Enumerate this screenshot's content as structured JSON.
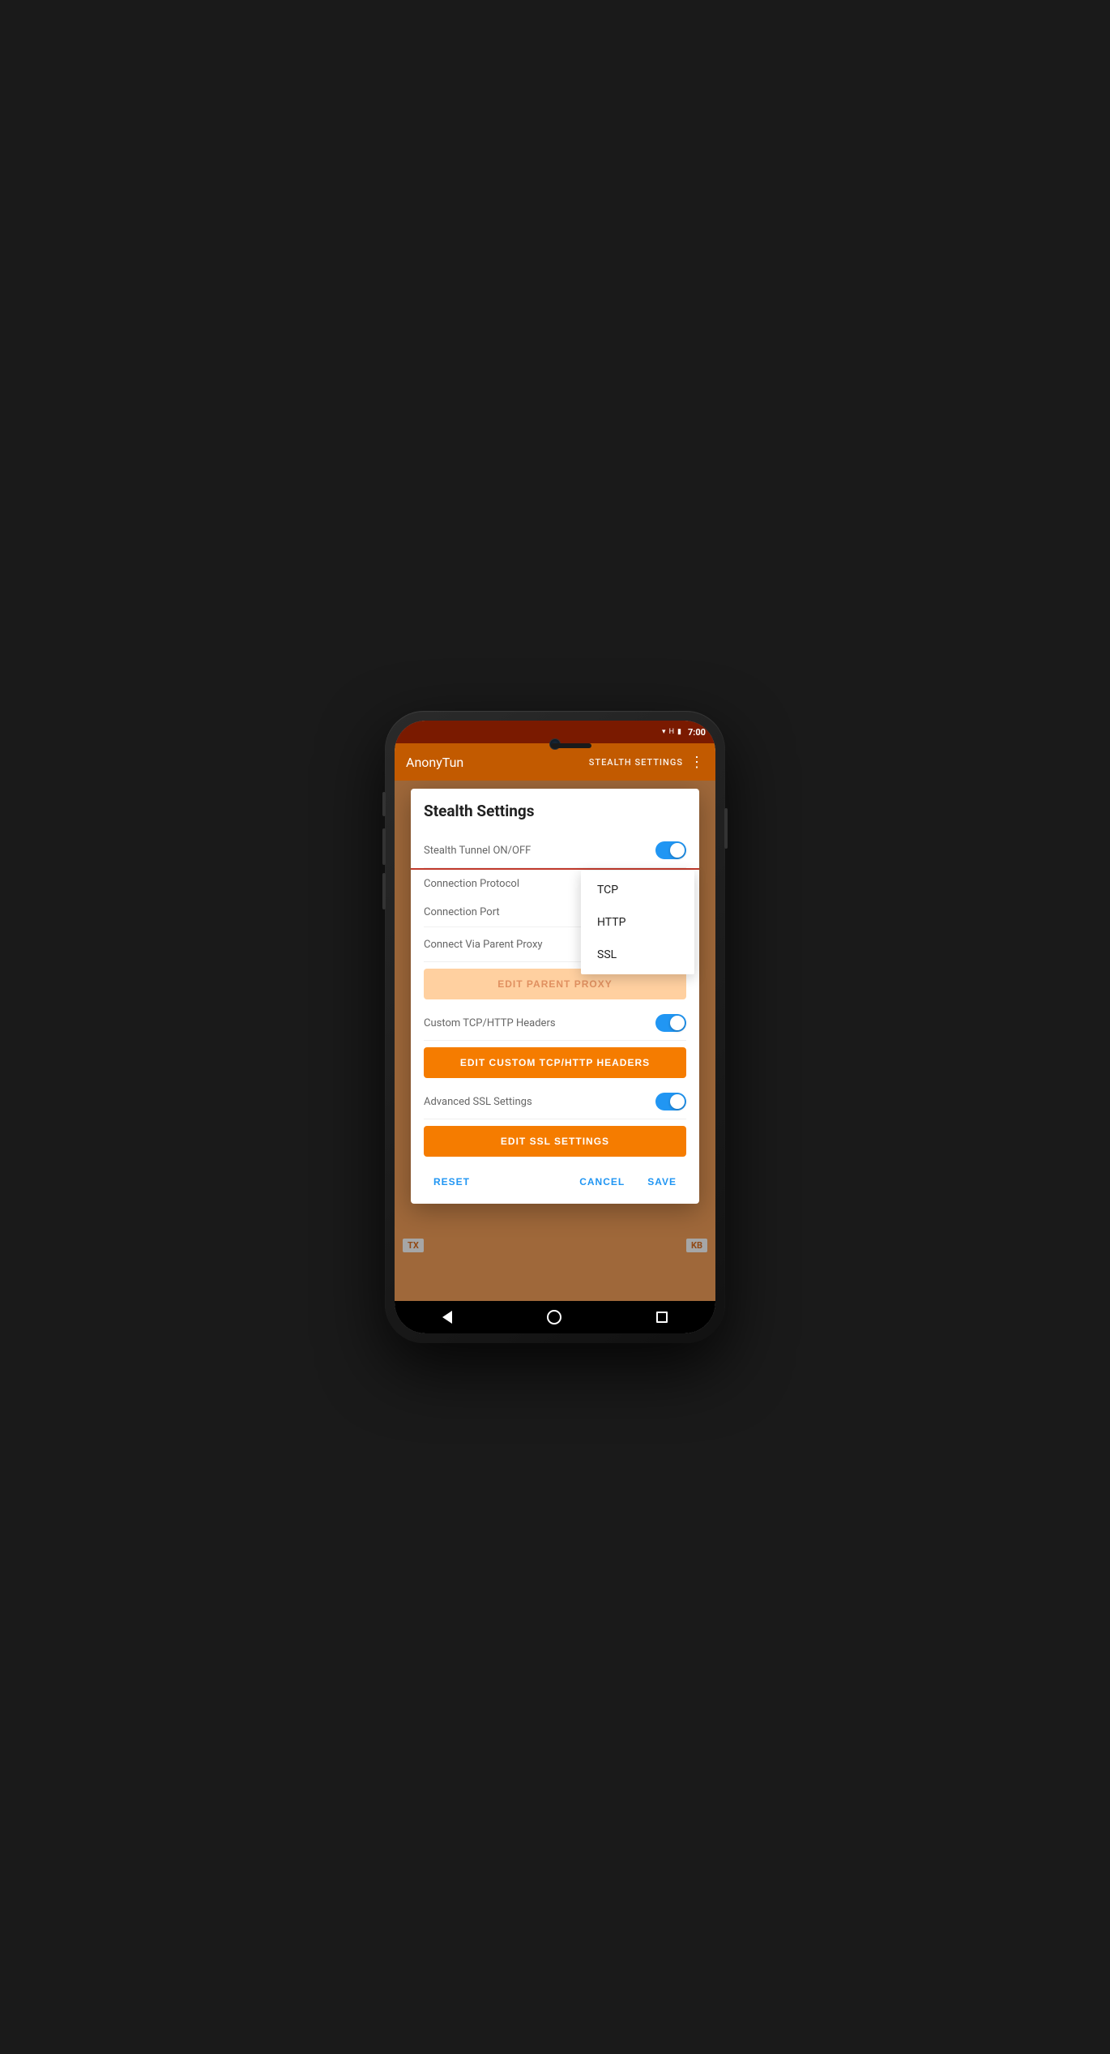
{
  "status_bar": {
    "time": "7:00",
    "wifi": "▼",
    "signal": "H",
    "battery": "100"
  },
  "app_bar": {
    "title": "AnonyTun",
    "section_label": "STEALTH SETTINGS",
    "more_icon": "⋮"
  },
  "dialog": {
    "title": "Stealth Settings",
    "settings": [
      {
        "label": "Stealth Tunnel ON/OFF",
        "type": "toggle",
        "value": true
      },
      {
        "label": "Connection Protocol",
        "type": "dropdown",
        "value": "TCP"
      },
      {
        "label": "Connection Port",
        "type": "text",
        "value": ""
      },
      {
        "label": "Connect Via Parent Proxy",
        "type": "toggle",
        "value": false
      }
    ],
    "edit_parent_proxy_label": "EDIT PARENT PROXY",
    "custom_tcp_label": "Custom TCP/HTTP Headers",
    "custom_tcp_toggle": true,
    "edit_custom_tcp_label": "EDIT CUSTOM TCP/HTTP HEADERS",
    "advanced_ssl_label": "Advanced SSL Settings",
    "advanced_ssl_toggle": true,
    "edit_ssl_label": "EDIT SSL SETTINGS",
    "actions": {
      "reset": "RESET",
      "cancel": "CANCEL",
      "save": "SAVE"
    }
  },
  "dropdown": {
    "options": [
      "TCP",
      "HTTP",
      "SSL"
    ],
    "arrow": "▼"
  },
  "background": {
    "tx_label": "TX",
    "kb_label": "KB"
  },
  "nav_bar": {
    "back": "◀",
    "home": "○",
    "recent": "□"
  }
}
